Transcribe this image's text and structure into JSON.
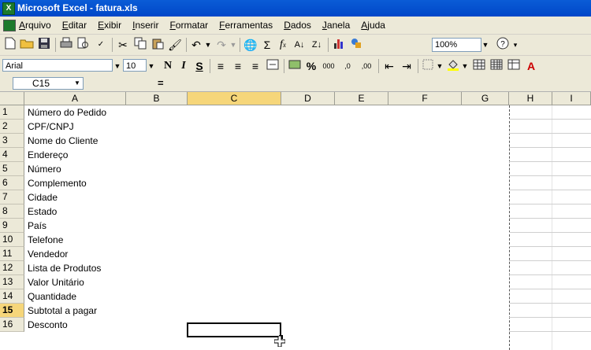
{
  "window": {
    "title": "Microsoft Excel - fatura.xls"
  },
  "menu": [
    "Arquivo",
    "Editar",
    "Exibir",
    "Inserir",
    "Formatar",
    "Ferramentas",
    "Dados",
    "Janela",
    "Ajuda"
  ],
  "toolbar": {
    "zoom": "100%"
  },
  "format_toolbar": {
    "font": "Arial",
    "size": "10",
    "bold": "N",
    "italic": "I",
    "underline": "S",
    "percent": "%",
    "thousands": "000"
  },
  "formula_bar": {
    "name_box": "C15",
    "equals": "="
  },
  "columns": [
    "A",
    "B",
    "C",
    "D",
    "E",
    "F",
    "G",
    "H",
    "I"
  ],
  "rows": [
    {
      "num": "1",
      "a": "Número do Pedido"
    },
    {
      "num": "2",
      "a": "CPF/CNPJ"
    },
    {
      "num": "3",
      "a": "Nome do Cliente"
    },
    {
      "num": "4",
      "a": "Endereço"
    },
    {
      "num": "5",
      "a": "Número"
    },
    {
      "num": "6",
      "a": "Complemento"
    },
    {
      "num": "7",
      "a": "Cidade"
    },
    {
      "num": "8",
      "a": "Estado"
    },
    {
      "num": "9",
      "a": "País"
    },
    {
      "num": "10",
      "a": "Telefone"
    },
    {
      "num": "11",
      "a": "Vendedor"
    },
    {
      "num": "12",
      "a": "Lista de Produtos"
    },
    {
      "num": "13",
      "a": "Valor Unitário"
    },
    {
      "num": "14",
      "a": "Quantidade"
    },
    {
      "num": "15",
      "a": "Subtotal a pagar"
    },
    {
      "num": "16",
      "a": "Desconto"
    }
  ],
  "active_cell": {
    "column": "C",
    "row": "15"
  },
  "colors": {
    "title_bar": "#0046c8",
    "chrome": "#ece9d8",
    "active_header": "#f6d67a"
  }
}
